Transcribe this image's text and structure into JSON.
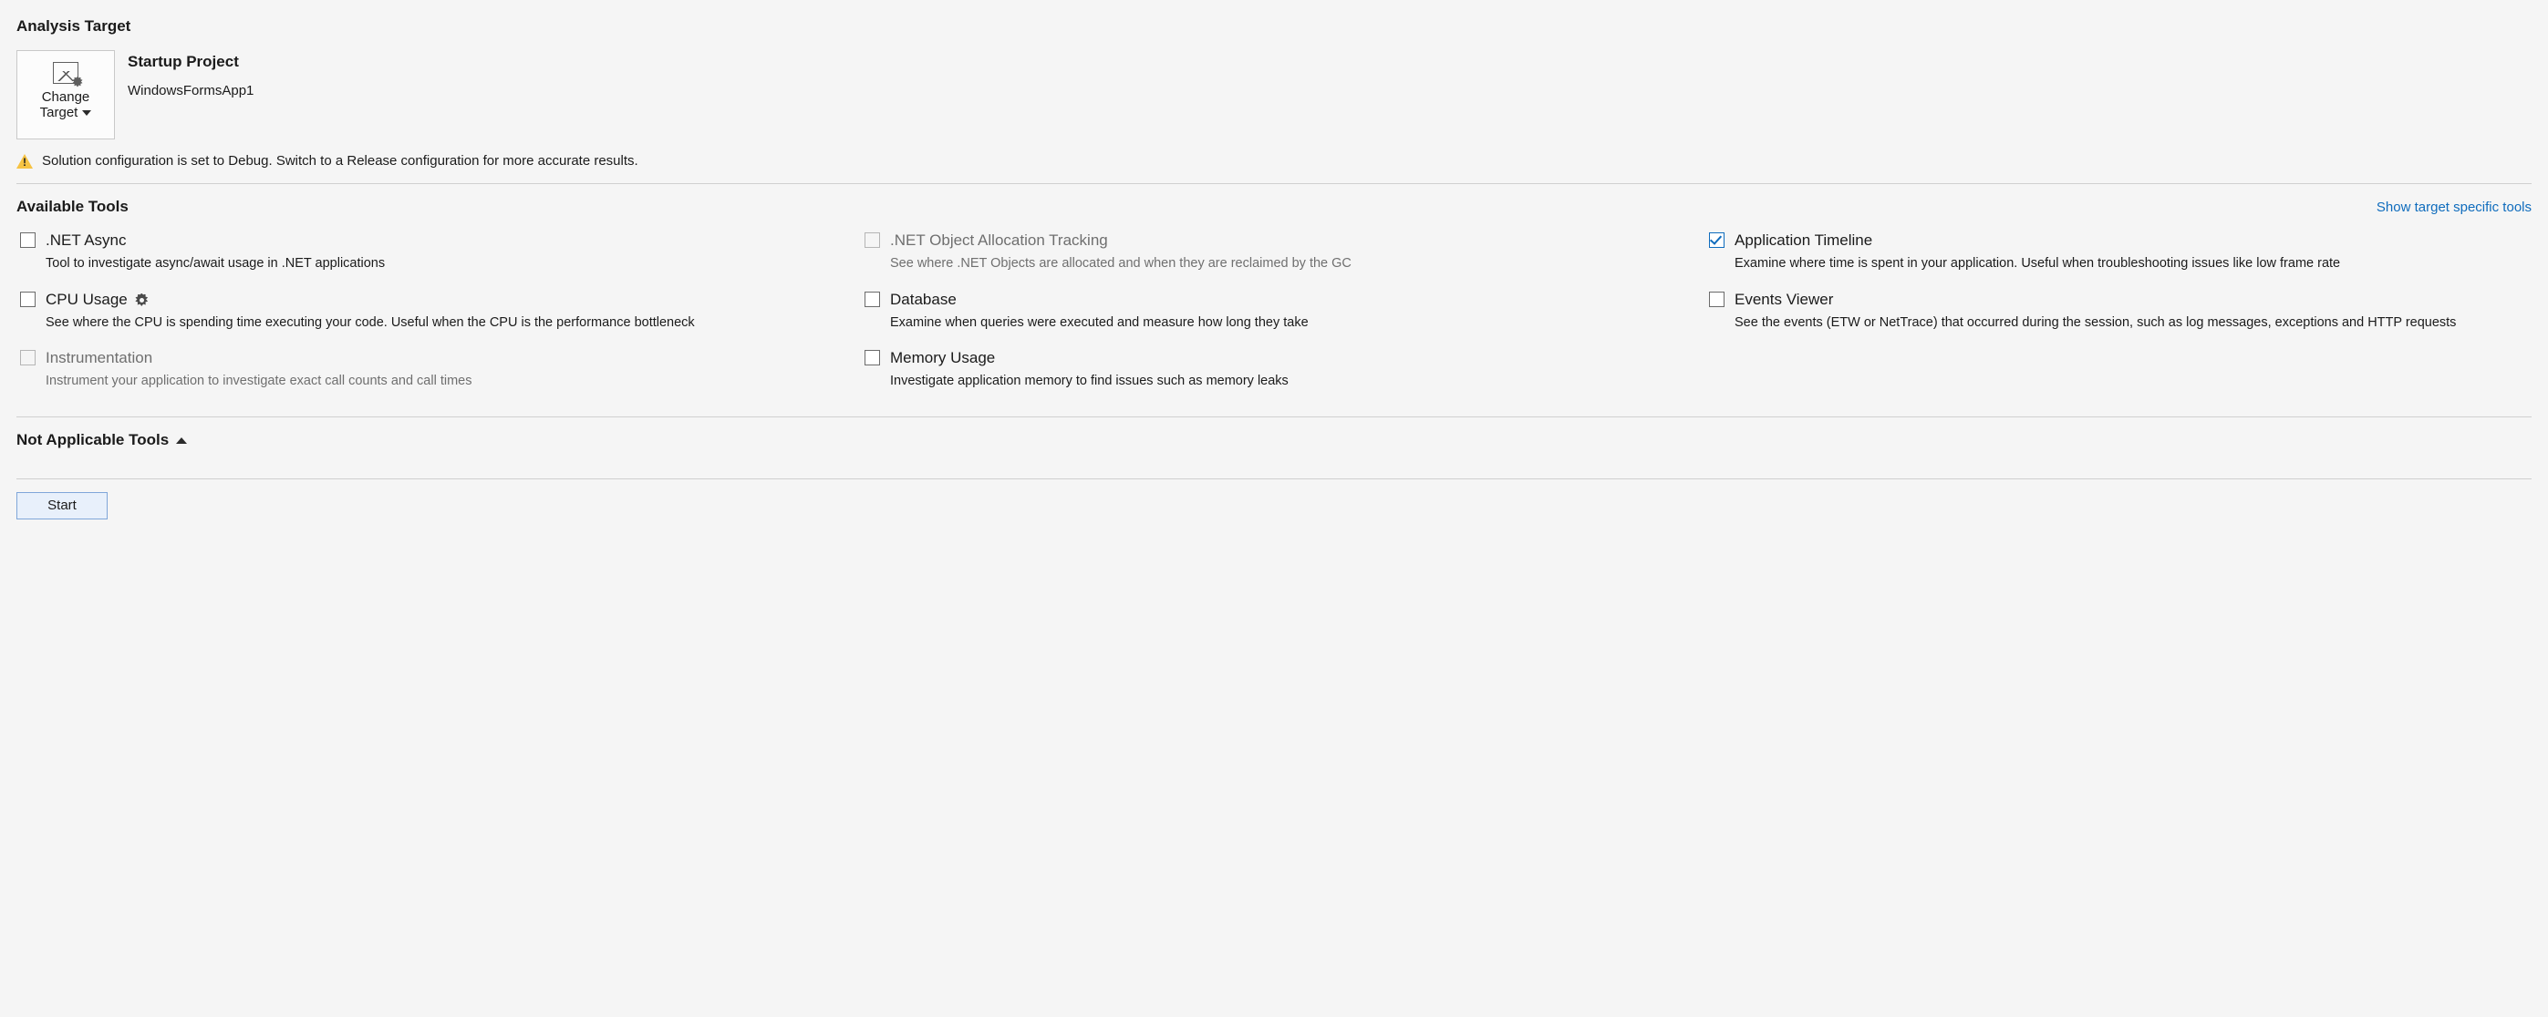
{
  "sections": {
    "analysis_target_title": "Analysis Target",
    "available_tools_title": "Available Tools",
    "not_applicable_title": "Not Applicable Tools"
  },
  "target": {
    "change_line1": "Change",
    "change_line2": "Target",
    "title": "Startup Project",
    "name": "WindowsFormsApp1"
  },
  "warning": {
    "text": "Solution configuration is set to Debug. Switch to a Release configuration for more accurate results."
  },
  "tools_header": {
    "show_target_specific": "Show target specific tools"
  },
  "tools": {
    "net_async": {
      "label": ".NET Async",
      "desc": "Tool to investigate async/await usage in .NET applications",
      "checked": false,
      "disabled": false,
      "has_gear": false
    },
    "net_obj_alloc": {
      "label": ".NET Object Allocation Tracking",
      "desc": "See where .NET Objects are allocated and when they are reclaimed by the GC",
      "checked": false,
      "disabled": true,
      "has_gear": false
    },
    "app_timeline": {
      "label": "Application Timeline",
      "desc": "Examine where time is spent in your application. Useful when troubleshooting issues like low frame rate",
      "checked": true,
      "disabled": false,
      "has_gear": false
    },
    "cpu_usage": {
      "label": "CPU Usage",
      "desc": "See where the CPU is spending time executing your code. Useful when the CPU is the performance bottleneck",
      "checked": false,
      "disabled": false,
      "has_gear": true
    },
    "database": {
      "label": "Database",
      "desc": "Examine when queries were executed and measure how long they take",
      "checked": false,
      "disabled": false,
      "has_gear": false
    },
    "events_viewer": {
      "label": "Events Viewer",
      "desc": "See the events (ETW or NetTrace) that occurred during the session, such as log messages, exceptions and HTTP requests",
      "checked": false,
      "disabled": false,
      "has_gear": false
    },
    "instrumentation": {
      "label": "Instrumentation",
      "desc": "Instrument your application to investigate exact call counts and call times",
      "checked": false,
      "disabled": true,
      "has_gear": false
    },
    "memory_usage": {
      "label": "Memory Usage",
      "desc": "Investigate application memory to find issues such as memory leaks",
      "checked": false,
      "disabled": false,
      "has_gear": false
    }
  },
  "footer": {
    "start": "Start"
  }
}
